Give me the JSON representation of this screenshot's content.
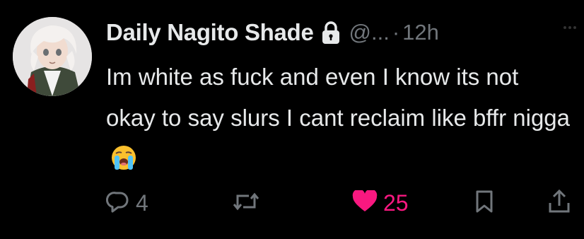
{
  "tweet": {
    "display_name": "Daily Nagito Shade",
    "handle": "@...",
    "separator": "·",
    "time": "12h",
    "protected_icon": "lock-icon",
    "text": "Im white as fuck and even I know its not okay to say slurs I cant reclaim like bffr nigga",
    "emoji": "loudly-crying-face-emoji"
  },
  "actions": {
    "reply": {
      "icon": "reply-icon",
      "count": "4"
    },
    "retweet": {
      "icon": "retweet-icon",
      "count": ""
    },
    "like": {
      "icon": "heart-icon",
      "count": "25",
      "liked": true,
      "color": "#f91880"
    },
    "bookmark": {
      "icon": "bookmark-icon"
    },
    "share": {
      "icon": "share-icon"
    }
  },
  "colors": {
    "background": "#000000",
    "primary_text": "#e7e9ea",
    "secondary_text": "#71767b",
    "like_pink": "#f91880"
  }
}
